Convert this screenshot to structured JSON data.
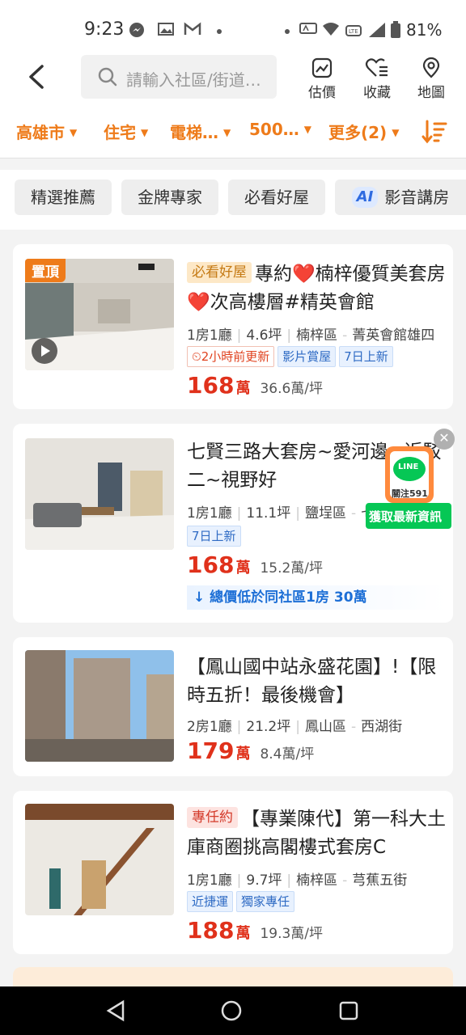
{
  "status_bar": {
    "time": "9:23",
    "battery": "81%"
  },
  "header": {
    "search_placeholder": "請輸入社區/街道…",
    "buttons": [
      {
        "label": "估價"
      },
      {
        "label": "收藏"
      },
      {
        "label": "地圖"
      }
    ]
  },
  "filters": [
    {
      "label": "高雄市"
    },
    {
      "label": "住宅"
    },
    {
      "label": "電梯…"
    },
    {
      "label": "500…"
    },
    {
      "label": "更多(2)"
    }
  ],
  "chips": [
    {
      "label": "精選推薦"
    },
    {
      "label": "金牌專家"
    },
    {
      "label": "必看好屋"
    },
    {
      "label": "影音講房",
      "badge": "AI"
    }
  ],
  "listings": [
    {
      "pin": "置頂",
      "title_tag": "必看好屋",
      "title": "專約❤️楠梓優質美套房❤️次高樓層#精英會館",
      "layout": "1房1廳",
      "area": "4.6坪",
      "district": "楠梓區",
      "street": "菁英會館雄四",
      "tags": [
        "2小時前更新",
        "影片賞屋",
        "7日上新"
      ],
      "price": "168",
      "price_unit": "萬",
      "unit_price": "36.6萬/坪"
    },
    {
      "title": "七賢三路大套房~愛河邊~近駁二~視野好",
      "layout": "1房1廳",
      "area": "11.1坪",
      "district": "鹽埕區",
      "street": "七",
      "tags": [
        "7日上新"
      ],
      "price": "168",
      "price_unit": "萬",
      "unit_price": "15.2萬/坪",
      "note": "總價低於同社區1房 30萬"
    },
    {
      "title": "【鳳山國中站永盛花園】!【限時五折！最後機會】",
      "layout": "2房1廳",
      "area": "21.2坪",
      "district": "鳳山區",
      "street": "西湖街",
      "price": "179",
      "price_unit": "萬",
      "unit_price": "8.4萬/坪"
    },
    {
      "title_tag": "專任約",
      "title": "【專業陳代】第一科大土庫商圈挑高閣樓式套房C",
      "layout": "1房1廳",
      "area": "9.7坪",
      "district": "楠梓區",
      "street": "芎蕉五街",
      "tags": [
        "近捷運",
        "獨家專任"
      ],
      "price": "188",
      "price_unit": "萬",
      "unit_price": "19.3萬/坪"
    }
  ],
  "line_ad": {
    "logo": "LINE",
    "sub": "關注591",
    "cta": "獲取最新資訊"
  },
  "colors": {
    "accent": "#ee7b1a",
    "price": "#e0311b",
    "line_green": "#06c755"
  }
}
